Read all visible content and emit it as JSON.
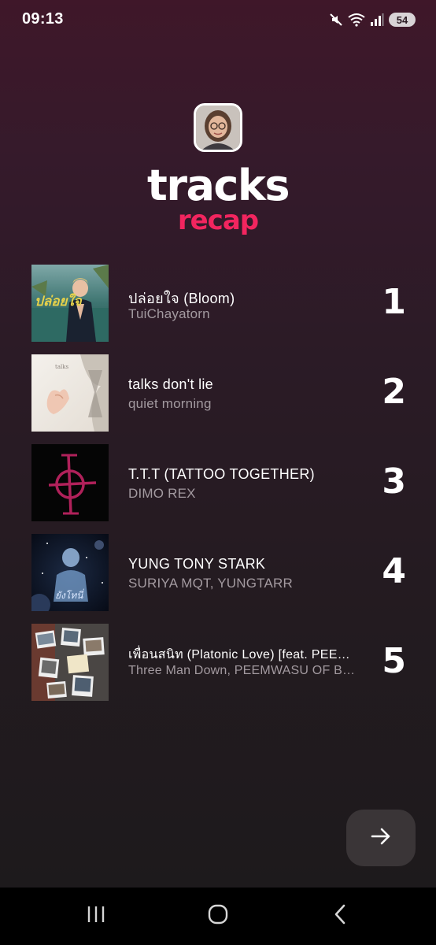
{
  "status_bar": {
    "time": "09:13",
    "battery": "54",
    "icons": [
      "mute-icon",
      "wifi-icon",
      "signal-icon",
      "battery-icon"
    ]
  },
  "header": {
    "avatar": "profile-avatar",
    "title": "tracks",
    "subtitle": "recap"
  },
  "colors": {
    "accent": "#f2255f",
    "background_top": "#3f1729",
    "background_bottom": "#1d1a1c",
    "artist_text": "#a39aa0"
  },
  "tracks": [
    {
      "rank": "1",
      "title": "ปล่อยใจ (Bloom)",
      "artist": "TuiChayatorn",
      "cover": "album-cover-bloom"
    },
    {
      "rank": "2",
      "title": "talks don't lie",
      "artist": "quiet morning",
      "cover": "album-cover-talks-dont-lie"
    },
    {
      "rank": "3",
      "title": "T.T.T (TATTOO TOGETHER)",
      "artist": "DIMO REX",
      "cover": "album-cover-ttt"
    },
    {
      "rank": "4",
      "title": "YUNG TONY STARK",
      "artist": "SURIYA MQT, YUNGTARR",
      "cover": "album-cover-yung-tony-stark"
    },
    {
      "rank": "5",
      "title": "เพื่อนสนิท (Platonic Love) [feat. PEEMWASU OF BUS]",
      "artist": "Three Man Down, PEEMWASU OF BUS",
      "cover": "album-cover-platonic-love"
    }
  ],
  "next_button": {
    "icon": "arrow-right-icon"
  },
  "nav_bar": {
    "buttons": [
      "recent-apps-icon",
      "home-icon",
      "back-icon"
    ]
  }
}
